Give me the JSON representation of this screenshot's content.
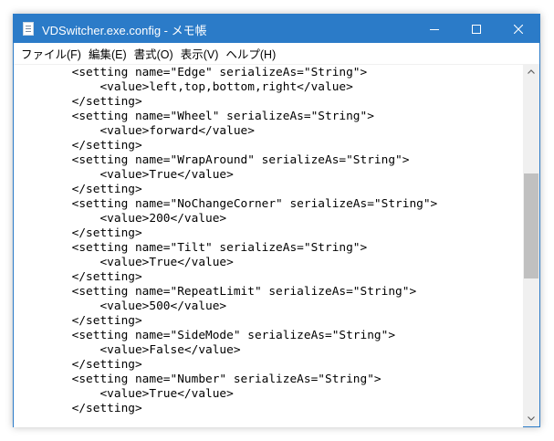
{
  "window": {
    "title": "VDSwitcher.exe.config - メモ帳",
    "accent_color": "#2b7bc8",
    "controls": [
      "minimize-icon",
      "maximize-icon",
      "close-icon"
    ]
  },
  "menu": {
    "items": [
      "ファイル(F)",
      "編集(E)",
      "書式(O)",
      "表示(V)",
      "ヘルプ(H)"
    ]
  },
  "editor": {
    "lines": [
      "        <setting name=\"Edge\" serializeAs=\"String\">",
      "            <value>left,top,bottom,right</value>",
      "        </setting>",
      "        <setting name=\"Wheel\" serializeAs=\"String\">",
      "            <value>forward</value>",
      "        </setting>",
      "        <setting name=\"WrapAround\" serializeAs=\"String\">",
      "            <value>True</value>",
      "        </setting>",
      "        <setting name=\"NoChangeCorner\" serializeAs=\"String\">",
      "            <value>200</value>",
      "        </setting>",
      "        <setting name=\"Tilt\" serializeAs=\"String\">",
      "            <value>True</value>",
      "        </setting>",
      "        <setting name=\"RepeatLimit\" serializeAs=\"String\">",
      "            <value>500</value>",
      "        </setting>",
      "        <setting name=\"SideMode\" serializeAs=\"String\">",
      "            <value>False</value>",
      "        </setting>",
      "        <setting name=\"Number\" serializeAs=\"String\">",
      "            <value>True</value>",
      "        </setting>"
    ]
  }
}
